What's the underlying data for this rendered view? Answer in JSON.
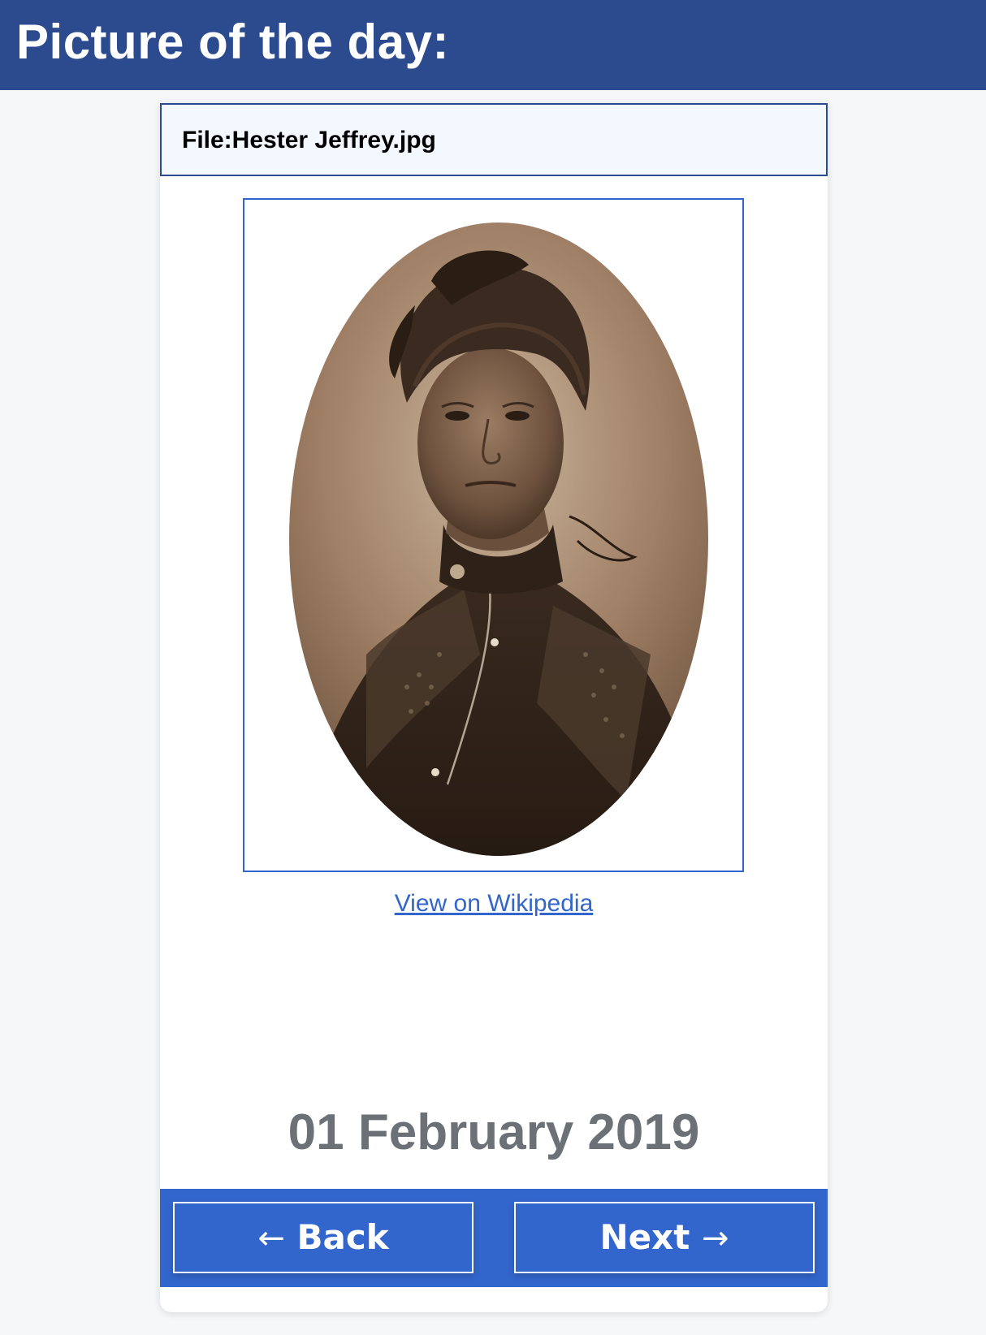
{
  "page": {
    "title": "Picture of the day:"
  },
  "card": {
    "file_name": "File:Hester Jeffrey.jpg",
    "image_alt": "Hester Jeffrey portrait",
    "link_text": "View on Wikipedia",
    "date": "01 February 2019"
  },
  "nav": {
    "back_arrow": "←",
    "back_label": "Back",
    "next_label": "Next",
    "next_arrow": "→"
  },
  "colors": {
    "banner": "#2c4b8f",
    "accent": "#3366cc",
    "date_text": "#6b7177",
    "header_bg": "#f2f8fe"
  }
}
